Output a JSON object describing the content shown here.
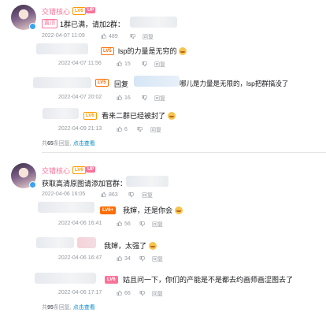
{
  "thread1": {
    "user": "交错核心",
    "level": "LV6",
    "up": "UP",
    "pinned": "置顶",
    "text": "1群已满，请加2群：",
    "date": "2022-04-07 11:09",
    "likes": "489",
    "reply_btn": "回复",
    "replies": [
      {
        "level": "LV5",
        "text": "lsp的力量是无穷的",
        "date": "2022-04-07 11:56",
        "likes": "15",
        "reply_btn": "回复"
      },
      {
        "level": "LV5",
        "text": "回复",
        "text2": "哪儿是力量是无限的，lsp把群搞没了",
        "date": "2022-04-07 20:02",
        "likes": "16",
        "reply_btn": "回复"
      },
      {
        "level": "LV6",
        "text": "看来二群已经被封了",
        "date": "2022-04-09 21:13",
        "likes": "6",
        "reply_btn": "回复"
      }
    ],
    "footer_pre": "共",
    "footer_count": "65",
    "footer_mid": "条回复,",
    "footer_link": "点击查看"
  },
  "thread2": {
    "user": "交错核心",
    "level": "LV6",
    "up": "UP",
    "text": "获取高清原图请添加官群：",
    "date": "2022-04-06 16:05",
    "likes": "863",
    "reply_btn": "回复",
    "replies": [
      {
        "level": "LV6+",
        "text": "我婶，还是你会",
        "date": "2022-04-06 16:41",
        "likes": "56",
        "reply_btn": "回复"
      },
      {
        "level": "",
        "text": "我婶，太强了",
        "date": "2022-04-06 16:47",
        "likes": "34",
        "reply_btn": "回复"
      },
      {
        "level": "LV6",
        "text": "姑且问一下，你们的产能是不是都去约画师画涩图去了",
        "date": "2022-04-06 17:17",
        "likes": "66",
        "reply_btn": "回复"
      }
    ],
    "footer_pre": "共",
    "footer_count": "95",
    "footer_mid": "条回复,",
    "footer_link": "点击查看"
  }
}
